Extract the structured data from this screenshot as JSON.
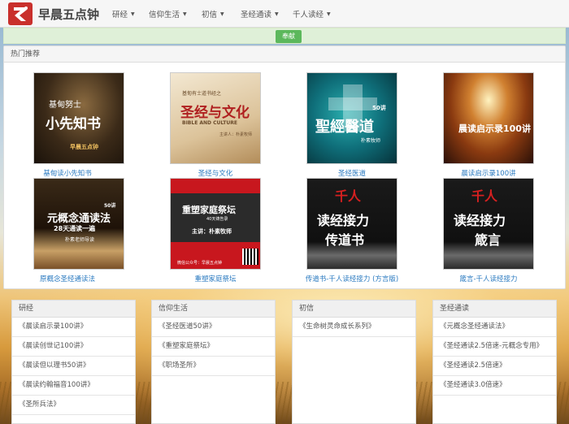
{
  "brand": {
    "name": "早晨五点钟"
  },
  "nav": [
    {
      "label": "研经"
    },
    {
      "label": "信仰生活"
    },
    {
      "label": "初信"
    },
    {
      "label": "圣经通读"
    },
    {
      "label": "千人读经"
    }
  ],
  "alert": {
    "button_label": "奉献"
  },
  "hot": {
    "heading": "热门推荐",
    "items": [
      {
        "title": "基甸读小先知书",
        "cover": [
          "基甸努士",
          "小先知书",
          "早晨五点钟"
        ]
      },
      {
        "title": "圣经与文化",
        "cover": [
          "基甸有士道书经之",
          "圣经与文化",
          "BIBLE AND CULTURE",
          "主讲人：朴素牧师"
        ]
      },
      {
        "title": "圣经医道",
        "cover": [
          "50讲",
          "聖經醫道",
          "朴素牧师"
        ]
      },
      {
        "title": "晨读启示录100讲",
        "cover": [
          "晨读启示录100讲"
        ]
      },
      {
        "title": "原概念圣经通读法",
        "cover": [
          "50讲",
          "元概念通读法",
          "28天通读一遍",
          "朴素老师导读"
        ]
      },
      {
        "title": "重塑家庭祭坛",
        "cover": [
          "重塑家庭祭坛",
          "40天祷告录",
          "主讲：朴素牧师",
          "微信公众号：早晨五点钟"
        ]
      },
      {
        "title": "传道书-千人读经接力 (方言版)",
        "cover": [
          "千人",
          "读经接力",
          "传道书"
        ]
      },
      {
        "title": "箴言-千人读经接力",
        "cover": [
          "千人",
          "读经接力",
          "箴言"
        ]
      }
    ]
  },
  "categories": [
    {
      "heading": "研经",
      "items": [
        "《晨读启示录100讲》",
        "《晨读创世记100讲》",
        "《晨读但以理书50讲》",
        "《晨读约翰福音100讲》",
        "《圣所兵法》"
      ]
    },
    {
      "heading": "信仰生活",
      "items": [
        "《圣经医道50讲》",
        "《重塑家庭祭坛》",
        "《职场圣所》"
      ]
    },
    {
      "heading": "初信",
      "items": [
        "《生命树灵命成长系列》"
      ]
    },
    {
      "heading": "圣经通读",
      "items": [
        "《元概念圣经通读法》",
        "《圣经通读2.5倍速-元概念专用》",
        "《圣经通读2.5倍速》",
        "《圣经通读3.0倍速》"
      ]
    }
  ],
  "colors": {
    "brand_red": "#c9302c",
    "link_blue": "#2a7ac0",
    "alert_green": "#dff0d8",
    "button_green": "#5cb85c"
  }
}
